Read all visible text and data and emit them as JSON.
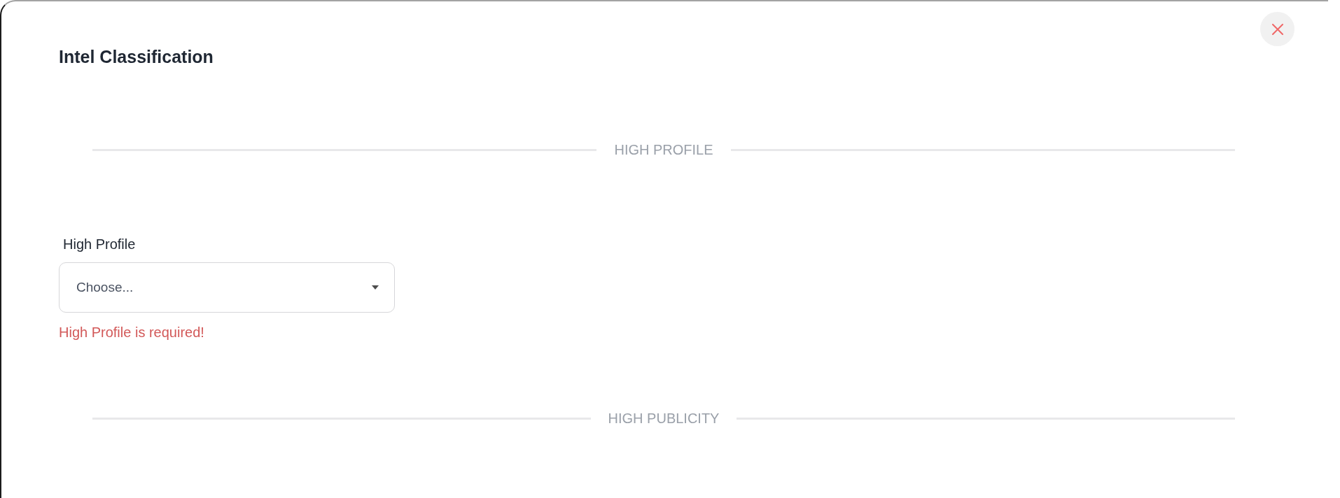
{
  "modal": {
    "title": "Intel Classification"
  },
  "sections": [
    {
      "heading": "HIGH PROFILE",
      "fields": [
        {
          "label": "High Profile",
          "placeholder": "Choose...",
          "error": "High Profile is required!"
        }
      ]
    },
    {
      "heading": "HIGH PUBLICITY"
    }
  ]
}
